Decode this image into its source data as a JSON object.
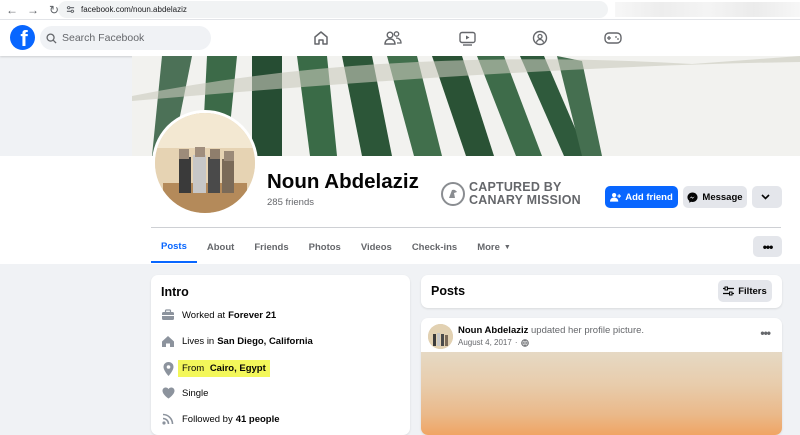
{
  "browser": {
    "url": "facebook.com/noun.abdelaziz"
  },
  "topnav": {
    "search_placeholder": "Search Facebook",
    "icons": [
      "home-icon",
      "friends-icon",
      "watch-icon",
      "groups-icon",
      "gaming-icon"
    ]
  },
  "profile": {
    "name": "Noun Abdelaziz",
    "friends": "285 friends",
    "overlay_line1": "CAPTURED BY",
    "overlay_line2": "CANARY MISSION",
    "add_friend_label": "Add friend",
    "message_label": "Message"
  },
  "tabs": [
    {
      "label": "Posts",
      "active": true
    },
    {
      "label": "About"
    },
    {
      "label": "Friends"
    },
    {
      "label": "Photos"
    },
    {
      "label": "Videos"
    },
    {
      "label": "Check-ins"
    },
    {
      "label": "More"
    }
  ],
  "intro": {
    "title": "Intro",
    "items": [
      {
        "prefix": "Worked at",
        "bold": "Forever 21",
        "icon": "briefcase-icon"
      },
      {
        "prefix": "Lives in",
        "bold": "San Diego, California",
        "icon": "home-icon"
      },
      {
        "prefix": "From",
        "bold": "Cairo, Egypt",
        "icon": "location-pin-icon",
        "highlighted": true
      },
      {
        "prefix": "Single",
        "bold": "",
        "icon": "heart-icon"
      },
      {
        "prefix": "Followed by",
        "bold": "41 people",
        "icon": "rss-icon"
      }
    ]
  },
  "posts": {
    "title": "Posts",
    "filters_label": "Filters"
  },
  "post": {
    "author": "Noun Abdelaziz",
    "action": "updated her profile picture.",
    "date": "August 4, 2017",
    "separator": "·"
  },
  "colors": {
    "brand_blue": "#0866ff",
    "highlight": "#f3f75a",
    "page_bg": "#f0f2f5"
  }
}
